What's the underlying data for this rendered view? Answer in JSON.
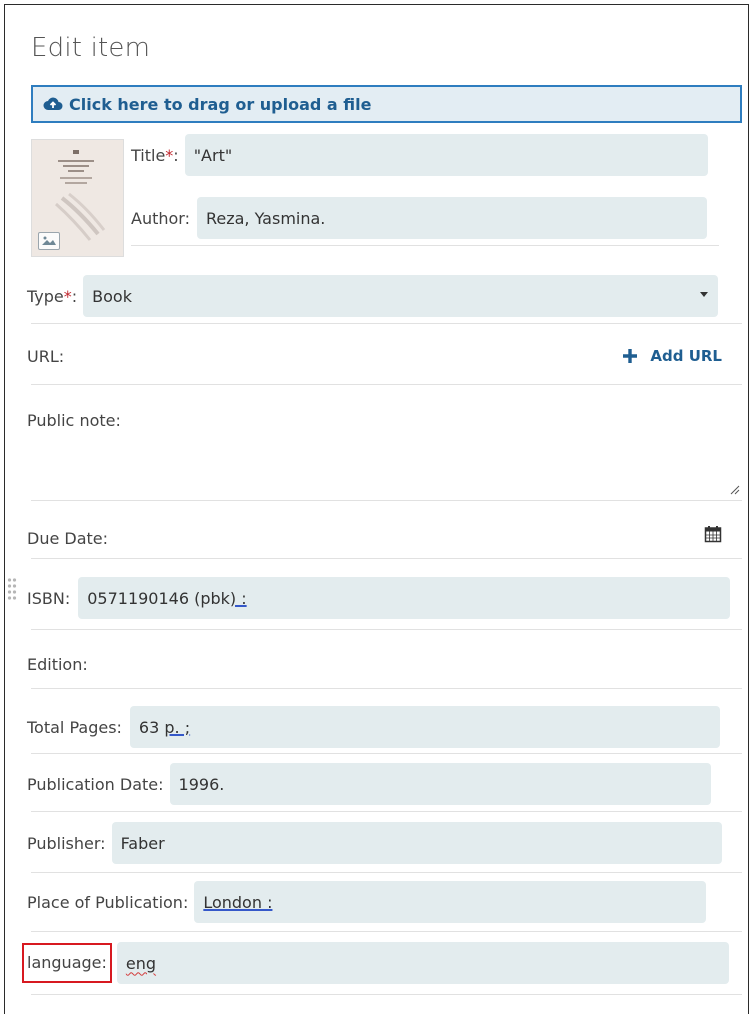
{
  "header": {
    "title": "Edit item",
    "upload_label": "Click here to drag or upload a file"
  },
  "fields": {
    "title": {
      "label": "Title",
      "value": "\"Art\""
    },
    "author": {
      "label": "Author:",
      "value": "Reza, Yasmina."
    },
    "type": {
      "label": "Type",
      "value": "Book"
    },
    "url": {
      "label": "URL:",
      "add_label": "Add URL"
    },
    "public_note": {
      "label": "Public note:"
    },
    "due_date": {
      "label": "Due Date:"
    },
    "isbn": {
      "label": "ISBN:",
      "value_main": "0571190146 (pbk",
      "value_tail": ") :"
    },
    "edition": {
      "label": "Edition:"
    },
    "total_pages": {
      "label": "Total Pages:",
      "value_main": "63 ",
      "value_tail": "p. ;"
    },
    "publication_date": {
      "label": "Publication Date:",
      "value": "1996."
    },
    "publisher": {
      "label": "Publisher:",
      "value": "Faber"
    },
    "place_of_publication": {
      "label": "Place of Publication:",
      "value": "London :"
    },
    "language": {
      "label": "language:",
      "value": "eng"
    }
  },
  "required_marker": "*",
  "colors": {
    "accent": "#2e7dbf",
    "field_bg": "#e3ecee",
    "required": "#c0262d",
    "highlight_box": "#d71920"
  },
  "icons": [
    "cloud-upload-icon",
    "image-placeholder-icon",
    "dropdown-caret-icon",
    "plus-icon",
    "calendar-icon",
    "resize-handle-icon",
    "drag-handle-icon"
  ]
}
